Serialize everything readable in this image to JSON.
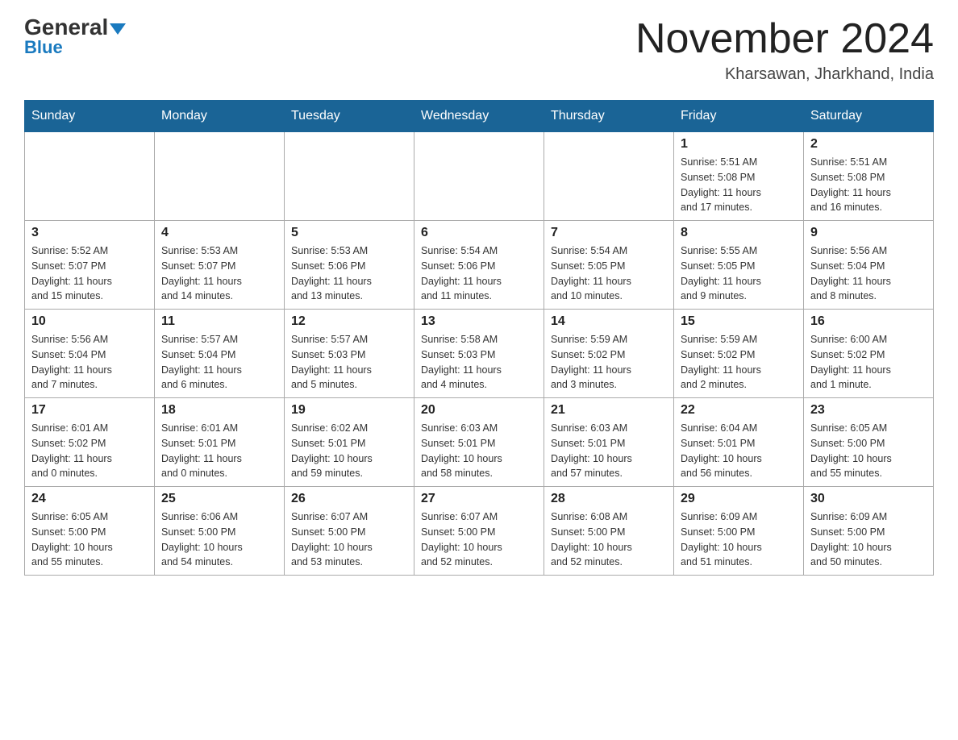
{
  "header": {
    "logo_general": "General",
    "logo_blue": "Blue",
    "month_title": "November 2024",
    "location": "Kharsawan, Jharkhand, India"
  },
  "weekdays": [
    "Sunday",
    "Monday",
    "Tuesday",
    "Wednesday",
    "Thursday",
    "Friday",
    "Saturday"
  ],
  "weeks": [
    {
      "days": [
        {
          "number": "",
          "info": ""
        },
        {
          "number": "",
          "info": ""
        },
        {
          "number": "",
          "info": ""
        },
        {
          "number": "",
          "info": ""
        },
        {
          "number": "",
          "info": ""
        },
        {
          "number": "1",
          "info": "Sunrise: 5:51 AM\nSunset: 5:08 PM\nDaylight: 11 hours\nand 17 minutes."
        },
        {
          "number": "2",
          "info": "Sunrise: 5:51 AM\nSunset: 5:08 PM\nDaylight: 11 hours\nand 16 minutes."
        }
      ]
    },
    {
      "days": [
        {
          "number": "3",
          "info": "Sunrise: 5:52 AM\nSunset: 5:07 PM\nDaylight: 11 hours\nand 15 minutes."
        },
        {
          "number": "4",
          "info": "Sunrise: 5:53 AM\nSunset: 5:07 PM\nDaylight: 11 hours\nand 14 minutes."
        },
        {
          "number": "5",
          "info": "Sunrise: 5:53 AM\nSunset: 5:06 PM\nDaylight: 11 hours\nand 13 minutes."
        },
        {
          "number": "6",
          "info": "Sunrise: 5:54 AM\nSunset: 5:06 PM\nDaylight: 11 hours\nand 11 minutes."
        },
        {
          "number": "7",
          "info": "Sunrise: 5:54 AM\nSunset: 5:05 PM\nDaylight: 11 hours\nand 10 minutes."
        },
        {
          "number": "8",
          "info": "Sunrise: 5:55 AM\nSunset: 5:05 PM\nDaylight: 11 hours\nand 9 minutes."
        },
        {
          "number": "9",
          "info": "Sunrise: 5:56 AM\nSunset: 5:04 PM\nDaylight: 11 hours\nand 8 minutes."
        }
      ]
    },
    {
      "days": [
        {
          "number": "10",
          "info": "Sunrise: 5:56 AM\nSunset: 5:04 PM\nDaylight: 11 hours\nand 7 minutes."
        },
        {
          "number": "11",
          "info": "Sunrise: 5:57 AM\nSunset: 5:04 PM\nDaylight: 11 hours\nand 6 minutes."
        },
        {
          "number": "12",
          "info": "Sunrise: 5:57 AM\nSunset: 5:03 PM\nDaylight: 11 hours\nand 5 minutes."
        },
        {
          "number": "13",
          "info": "Sunrise: 5:58 AM\nSunset: 5:03 PM\nDaylight: 11 hours\nand 4 minutes."
        },
        {
          "number": "14",
          "info": "Sunrise: 5:59 AM\nSunset: 5:02 PM\nDaylight: 11 hours\nand 3 minutes."
        },
        {
          "number": "15",
          "info": "Sunrise: 5:59 AM\nSunset: 5:02 PM\nDaylight: 11 hours\nand 2 minutes."
        },
        {
          "number": "16",
          "info": "Sunrise: 6:00 AM\nSunset: 5:02 PM\nDaylight: 11 hours\nand 1 minute."
        }
      ]
    },
    {
      "days": [
        {
          "number": "17",
          "info": "Sunrise: 6:01 AM\nSunset: 5:02 PM\nDaylight: 11 hours\nand 0 minutes."
        },
        {
          "number": "18",
          "info": "Sunrise: 6:01 AM\nSunset: 5:01 PM\nDaylight: 11 hours\nand 0 minutes."
        },
        {
          "number": "19",
          "info": "Sunrise: 6:02 AM\nSunset: 5:01 PM\nDaylight: 10 hours\nand 59 minutes."
        },
        {
          "number": "20",
          "info": "Sunrise: 6:03 AM\nSunset: 5:01 PM\nDaylight: 10 hours\nand 58 minutes."
        },
        {
          "number": "21",
          "info": "Sunrise: 6:03 AM\nSunset: 5:01 PM\nDaylight: 10 hours\nand 57 minutes."
        },
        {
          "number": "22",
          "info": "Sunrise: 6:04 AM\nSunset: 5:01 PM\nDaylight: 10 hours\nand 56 minutes."
        },
        {
          "number": "23",
          "info": "Sunrise: 6:05 AM\nSunset: 5:00 PM\nDaylight: 10 hours\nand 55 minutes."
        }
      ]
    },
    {
      "days": [
        {
          "number": "24",
          "info": "Sunrise: 6:05 AM\nSunset: 5:00 PM\nDaylight: 10 hours\nand 55 minutes."
        },
        {
          "number": "25",
          "info": "Sunrise: 6:06 AM\nSunset: 5:00 PM\nDaylight: 10 hours\nand 54 minutes."
        },
        {
          "number": "26",
          "info": "Sunrise: 6:07 AM\nSunset: 5:00 PM\nDaylight: 10 hours\nand 53 minutes."
        },
        {
          "number": "27",
          "info": "Sunrise: 6:07 AM\nSunset: 5:00 PM\nDaylight: 10 hours\nand 52 minutes."
        },
        {
          "number": "28",
          "info": "Sunrise: 6:08 AM\nSunset: 5:00 PM\nDaylight: 10 hours\nand 52 minutes."
        },
        {
          "number": "29",
          "info": "Sunrise: 6:09 AM\nSunset: 5:00 PM\nDaylight: 10 hours\nand 51 minutes."
        },
        {
          "number": "30",
          "info": "Sunrise: 6:09 AM\nSunset: 5:00 PM\nDaylight: 10 hours\nand 50 minutes."
        }
      ]
    }
  ]
}
